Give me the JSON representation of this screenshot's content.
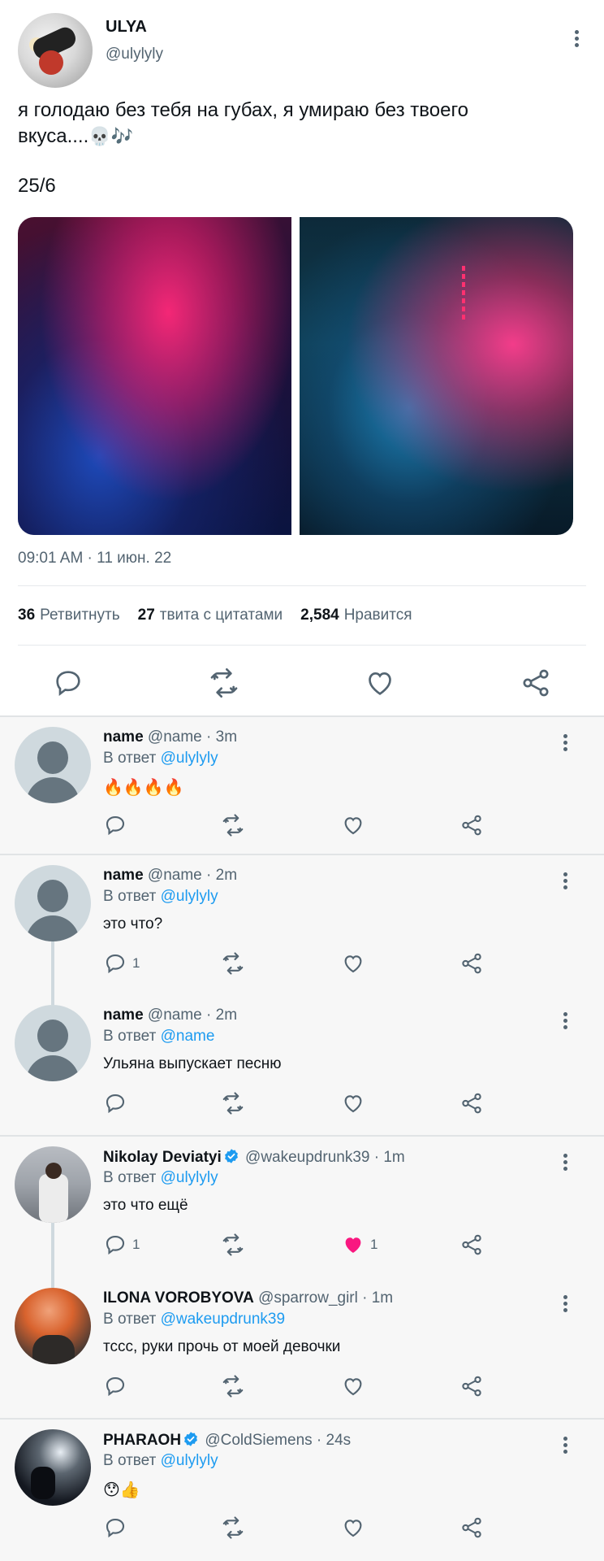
{
  "main_tweet": {
    "author_name": "ULYA",
    "author_handle": "@ulylyly",
    "text_line1": "я голодаю без тебя на губах, я умираю без твоего",
    "text_line2": "вкуса....",
    "text_emoji": "💀🎶",
    "text_line3": "25/6",
    "timestamp": "09:01 AM · 11 июн. 22",
    "stats": {
      "retweets_count": "36",
      "retweets_label": "Ретвитнуть",
      "quotes_count": "27",
      "quotes_label": "твита с цитатами",
      "likes_count": "2,584",
      "likes_label": "Нравится"
    },
    "media": [
      "photo-1",
      "photo-2"
    ]
  },
  "replies": [
    {
      "name": "name",
      "meta": "@name · 3m",
      "reply_prefix": "В ответ",
      "reply_to": "@ulylyly",
      "text": "🔥🔥🔥🔥",
      "reply_count": "",
      "like_count": "",
      "liked": false,
      "verified": false
    },
    {
      "name": "name",
      "meta": "@name · 2m",
      "reply_prefix": "В ответ",
      "reply_to": "@ulylyly",
      "text": "это что?",
      "reply_count": "1",
      "like_count": "",
      "liked": false,
      "verified": false
    },
    {
      "name": "name",
      "meta": "@name · 2m",
      "reply_prefix": "В ответ",
      "reply_to": "@name",
      "text": "Ульяна выпускает песню",
      "reply_count": "",
      "like_count": "",
      "liked": false,
      "verified": false
    },
    {
      "name": "Nikolay Deviatyi",
      "meta": "@wakeupdrunk39 · 1m",
      "reply_prefix": "В ответ",
      "reply_to": "@ulylyly",
      "text": "это что ещё",
      "reply_count": "1",
      "like_count": "1",
      "liked": true,
      "verified": true
    },
    {
      "name": "ILONA VOROBYOVA",
      "meta": "@sparrow_girl · 1m",
      "reply_prefix": "В ответ",
      "reply_to": "@wakeupdrunk39",
      "text": "тссс, руки прочь от моей девочки",
      "reply_count": "",
      "like_count": "",
      "liked": false,
      "verified": false
    },
    {
      "name": "PHARAOH",
      "meta": "@ColdSiemens · 24s",
      "reply_prefix": "В ответ",
      "reply_to": "@ulylyly",
      "text": "😯👍",
      "reply_count": "",
      "like_count": "",
      "liked": false,
      "verified": true
    }
  ],
  "colors": {
    "accent": "#1d9bf0",
    "like": "#f91880",
    "muted": "#536471"
  }
}
